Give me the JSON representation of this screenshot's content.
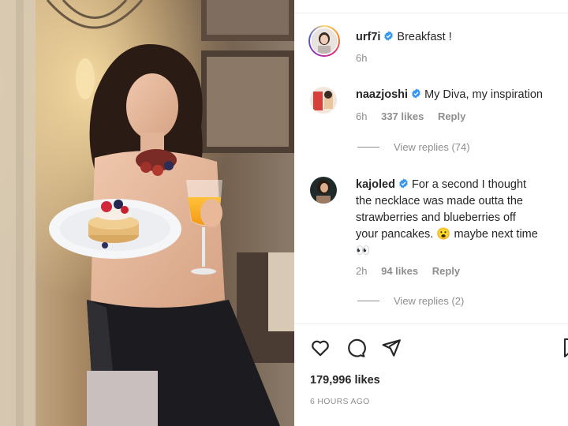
{
  "post": {
    "author": "urf7i",
    "caption": "Breakfast !",
    "age": "6h"
  },
  "comments": [
    {
      "user": "naazjoshi",
      "text": "My Diva, my inspiration",
      "age": "6h",
      "likes": "337 likes",
      "reply_label": "Reply",
      "view_replies": "View replies (74)"
    },
    {
      "user": "kajoled",
      "text_lines": [
        "For a second I thought",
        "the necklace was made outta the",
        "strawberries and blueberries off",
        "your pancakes. 😮 maybe next time",
        "👀"
      ],
      "age": "2h",
      "likes": "94 likes",
      "reply_label": "Reply",
      "view_replies": "View replies (2)"
    }
  ],
  "actions": {
    "like_icon": "heart-icon",
    "comment_icon": "comment-icon",
    "share_icon": "share-icon",
    "save_icon": "bookmark-icon"
  },
  "stats": {
    "likes": "179,996 likes",
    "posted": "6 HOURS AGO"
  },
  "colors": {
    "verified": "#3897f0",
    "muted": "#8e8e8e",
    "text": "#262626"
  }
}
